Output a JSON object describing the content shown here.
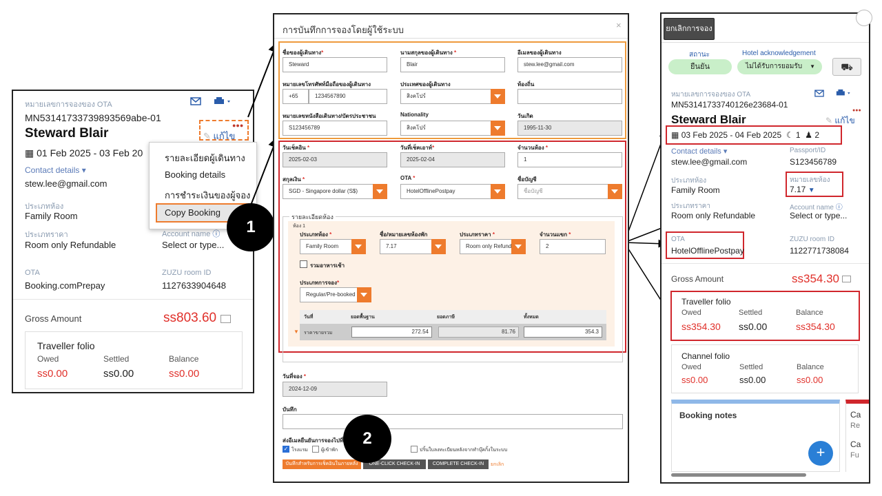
{
  "left": {
    "ota_ref_label": "หมายเลขการจองของ OTA",
    "ota_ref": "MN53141733739893569abe-01",
    "guest_name": "Steward Blair",
    "edit_label": "แก้ไข",
    "dates": "01 Feb 2025 - 03 Feb 20",
    "contact_label": "Contact details",
    "email": "stew.lee@gmail.com",
    "room_type_label": "ประเภทห้อง",
    "room_type": "Family Room",
    "rate_type_label": "ประเภทราคา",
    "rate_type": "Room only Refundable",
    "account_label": "Account name",
    "account_value": "Select or type...",
    "ota_label": "OTA",
    "ota_value": "Booking.comPrepay",
    "zuzu_label": "ZUZU room ID",
    "zuzu_value": "1127633904648",
    "gross_label": "Gross Amount",
    "gross_value": "ss803.60",
    "folio_title": "Traveller folio",
    "owed_label": "Owed",
    "settled_label": "Settled",
    "balance_label": "Balance",
    "owed": "ss0.00",
    "settled": "ss0.00",
    "balance": "ss0.00",
    "menu": [
      "รายละเอียดผู้เดินทาง",
      "Booking details",
      "การชำระเงินของผู้จอง",
      "Copy Booking"
    ]
  },
  "markers": {
    "one": "1",
    "two": "2"
  },
  "modal": {
    "title": "การบันทึกการจองโดยผู้ใช้ระบบ",
    "close": "×",
    "first_name_label": "ชื่อของผู้เดินทาง",
    "first_name": "Steward",
    "last_name_label": "นามสกุลของผู้เดินทาง",
    "last_name": "Blair",
    "email_label": "อีเมลของผู้เดินทาง",
    "email": "stew.lee@gmail.com",
    "phone_label": "หมายเลขโทรศัพท์มือถือของผู้เดินทาง",
    "phone_code": "+65",
    "phone": "1234567890",
    "country_label": "ประเทศของผู้เดินทาง",
    "country": "สิงคโปร์",
    "local_label": "ท้องถิ่น",
    "passport_label": "หมายเลขหนังสือเดินทาง/บัตรประชาชน",
    "passport": "S123456789",
    "nationality_label": "Nationality",
    "nationality": "สิงคโปร์",
    "dob_label": "วันเกิด",
    "dob": "1995-11-30",
    "checkin_label": "วันเช็คอิน",
    "checkin": "2025-02-03",
    "checkout_label": "วันที่เช็คเอาท์",
    "checkout": "2025-02-04",
    "rooms_label": "จำนวนห้อง",
    "rooms": "1",
    "currency_label": "สกุลเงิน",
    "currency": "SGD - Singapore dollar (S$)",
    "ota_label": "OTA",
    "ota": "HotelOfflinePostpay",
    "account_label": "ชื่อบัญชี",
    "account_placeholder": "ชื่อบัญชี",
    "room_details_legend": "รายละเอียดห้อง",
    "room_no": "ห้อง 1",
    "room_type_label": "ประเภทห้อง",
    "room_type": "Family Room",
    "room_number_label": "ชื่อ/หมายเลขห้องพัก",
    "room_number": "7.17",
    "rate_type_label": "ประเภทราคา",
    "rate_type": "Room only Refunda",
    "guests_label": "จำนวนแขก",
    "guests": "2",
    "breakfast_label": "รวมอาหารเช้า",
    "booking_type_label": "ประเภทการจอง",
    "booking_type": "Regular/Pre-booked",
    "table_headers": [
      "วันที่",
      "ยอดพื้นฐาน",
      "ยอดภาษี",
      "ทั้งหมด"
    ],
    "table_row_label": "ราคาขายรวม",
    "base": "272.54",
    "tax": "81.76",
    "total": "354.3",
    "booking_date_label": "วันที่จอง",
    "booking_date": "2024-12-09",
    "note_label": "บันทึก",
    "send_label": "ส่งอีเมลยืนยันการจองไปที่",
    "cb_hotel": "โรงแรม",
    "cb_guest": "ผู้เข้าพัก",
    "cb_notify": "ปริ้นใบลงทะเบียนหลังจากทำบุ๊คกิ้งในระบบ",
    "btn_save": "บันทึกสำหรับการเช็คอินในภายหลัง",
    "btn_one_click": "ONE-CLICK CHECK-IN",
    "btn_complete": "COMPLETE CHECK-IN",
    "btn_cancel": "ยกเลิก"
  },
  "right": {
    "cancel_btn": "ยกเลิกการจอง",
    "status_label": "สถานะ",
    "status": "ยืนยัน",
    "ack_label": "Hotel acknowledgement",
    "ack": "ไม่ได้รับการยอมรับ",
    "ota_ref_label": "หมายเลขการจองของ OTA",
    "ota_ref": "MN53141733740126e23684-01",
    "guest_name": "Steward Blair",
    "edit_label": "แก้ไข",
    "dates": "03 Feb 2025 - 04 Feb 2025",
    "nights": "1",
    "guests": "2",
    "contact_label": "Contact details",
    "email": "stew.lee@gmail.com",
    "passport_label": "Passport/ID",
    "passport": "S123456789",
    "room_type_label": "ประเภทห้อง",
    "room_type": "Family Room",
    "room_no_label": "หมายเลขห้อง",
    "room_no": "7.17",
    "rate_type_label": "ประเภทราคา",
    "rate_type": "Room only Refundable",
    "account_label": "Account name",
    "account_value": "Select or type...",
    "ota_label": "OTA",
    "ota_value": "HotelOfflinePostpay",
    "zuzu_label": "ZUZU room ID",
    "zuzu_value": "1122771738084",
    "gross_label": "Gross Amount",
    "gross_value": "ss354.30",
    "traveller_title": "Traveller folio",
    "channel_title": "Channel folio",
    "owed_label": "Owed",
    "settled_label": "Settled",
    "balance_label": "Balance",
    "t_owed": "ss354.30",
    "t_settled": "ss0.00",
    "t_balance": "ss354.30",
    "c_owed": "ss0.00",
    "c_settled": "ss0.00",
    "c_balance": "ss0.00",
    "notes_title": "Booking notes",
    "side_c1": "Ca",
    "side_r1": "Re",
    "side_c2": "Ca",
    "side_f2": "Fu",
    "fab": "+"
  }
}
